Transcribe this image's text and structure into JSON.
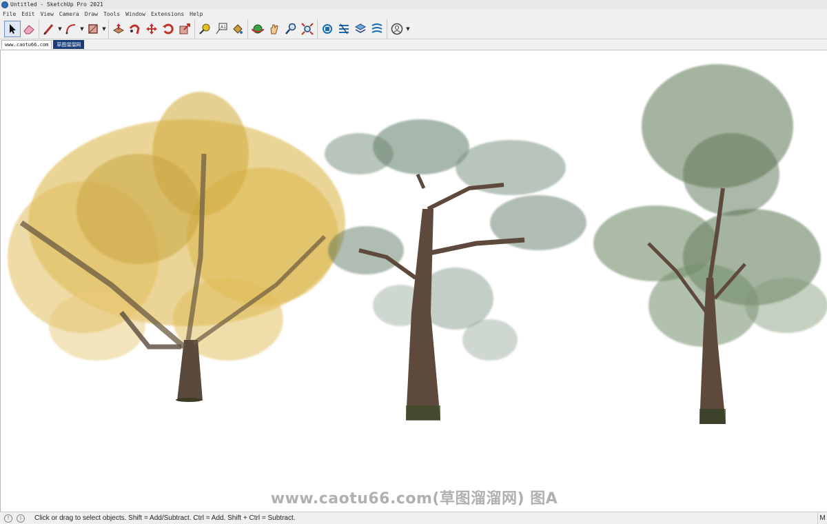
{
  "window": {
    "title": "Untitled - SketchUp Pro 2021"
  },
  "menu": [
    "File",
    "Edit",
    "View",
    "Camera",
    "Draw",
    "Tools",
    "Window",
    "Extensions",
    "Help"
  ],
  "toolbar": {
    "tools": [
      "select-icon",
      "eraser-icon",
      "line-icon",
      "arc-icon",
      "rectangle-icon",
      "push-pull-icon",
      "follow-me-icon",
      "move-icon",
      "rotate-icon",
      "scale-icon",
      "tape-measure-icon",
      "text-icon",
      "paint-bucket-icon",
      "orbit-icon",
      "pan-icon",
      "zoom-icon",
      "zoom-extents-icon",
      "warehouse-icon",
      "extension-warehouse-icon",
      "layers-icon",
      "sandbox-icon",
      "account-icon"
    ]
  },
  "tabs": [
    "www.caotu66.com",
    "草图溜溜网"
  ],
  "viewport": {
    "watermark": "www.caotu66.com(草图溜溜网) 图A"
  },
  "colors": {
    "ginkgo": "#d4a520",
    "pine": "#5c7a62",
    "broadleaf": "#4f6d45",
    "trunk": "#5a4a3e"
  },
  "status": {
    "message": "Click or drag to select objects. Shift = Add/Subtract. Ctrl = Add. Shift + Ctrl = Subtract.",
    "right": "M"
  }
}
